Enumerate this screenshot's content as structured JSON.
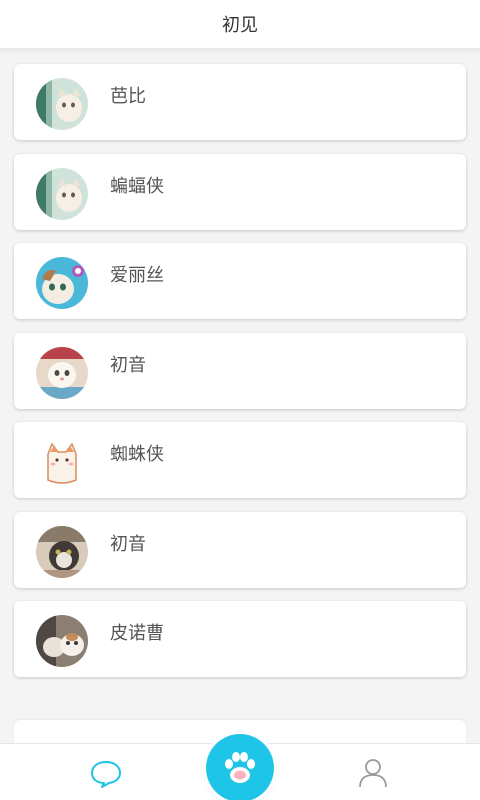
{
  "header": {
    "title": "初见"
  },
  "contacts": [
    {
      "name": "芭比",
      "avatar": "cat-photo-1"
    },
    {
      "name": "蝙蝠侠",
      "avatar": "cat-photo-2"
    },
    {
      "name": "爱丽丝",
      "avatar": "cat-photo-3"
    },
    {
      "name": "初音",
      "avatar": "cat-photo-4"
    },
    {
      "name": "蜘蛛侠",
      "avatar": "cat-drawing"
    },
    {
      "name": "初音",
      "avatar": "cat-photo-5"
    },
    {
      "name": "皮诺曹",
      "avatar": "cat-photo-6"
    }
  ],
  "tabs": {
    "left_icon": "chat-bubble-icon",
    "center_icon": "paw-icon",
    "right_icon": "user-icon"
  },
  "colors": {
    "accent": "#1fc5e6",
    "text": "#555555",
    "background": "#f4f4f4"
  }
}
